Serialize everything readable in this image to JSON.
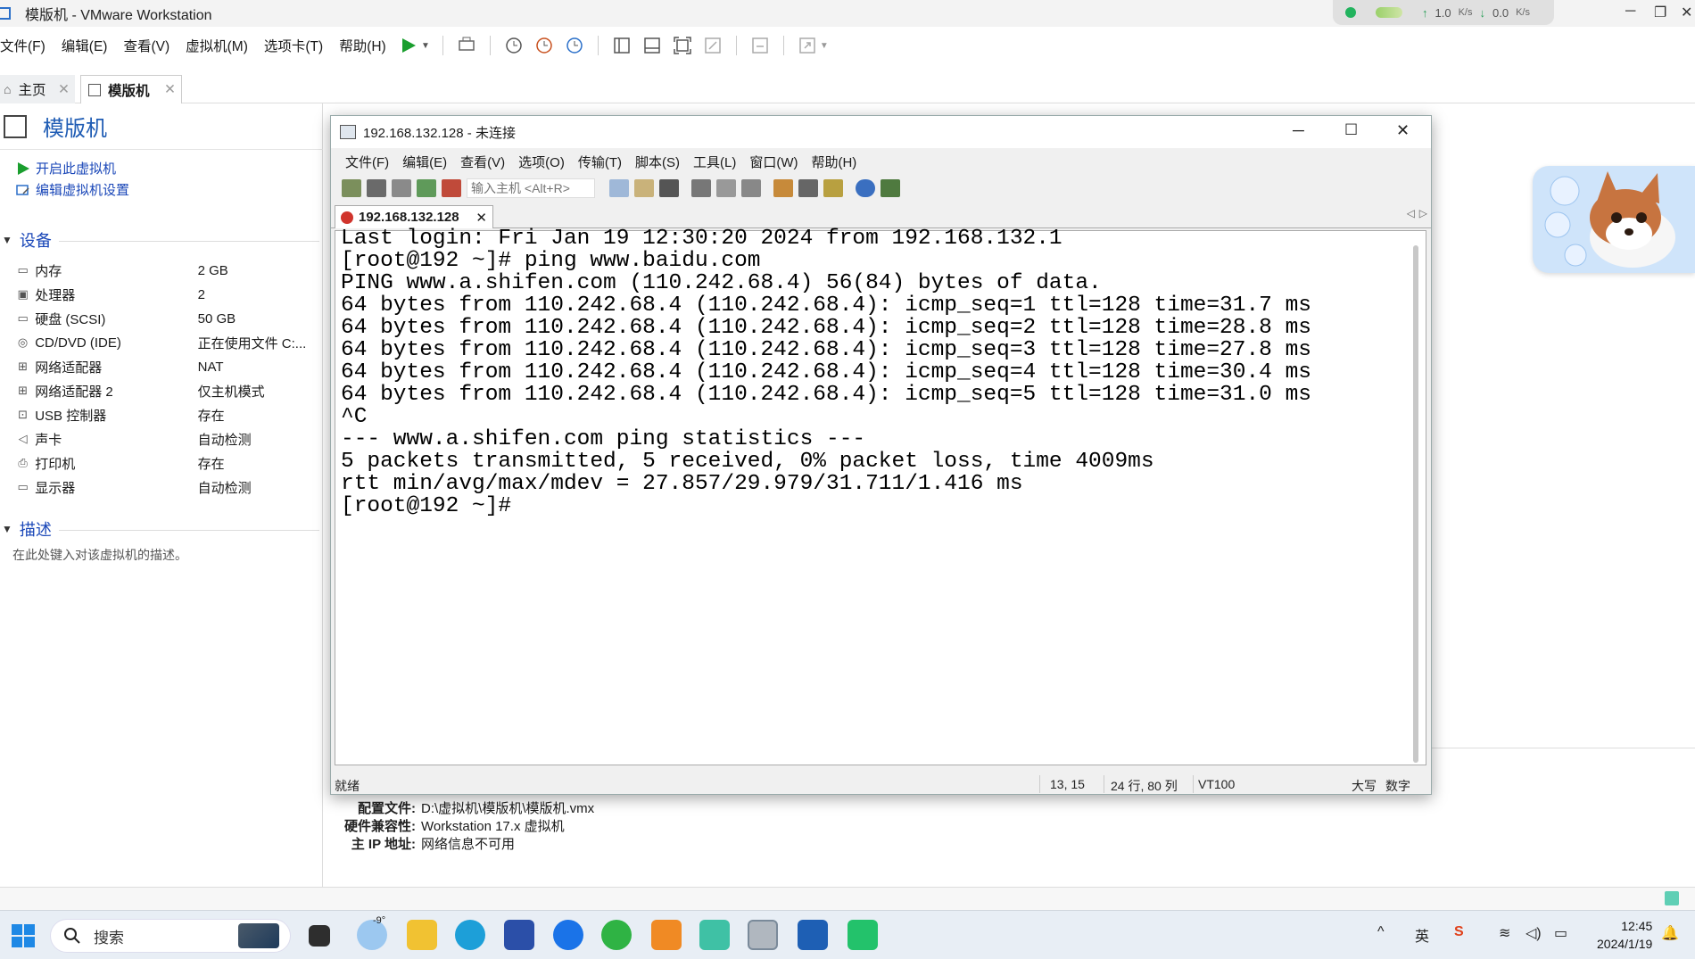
{
  "window": {
    "title": "模版机 - VMware Workstation"
  },
  "net": {
    "up": "1.0",
    "up_unit": "K/s",
    "down": "0.0",
    "down_unit": "K/s"
  },
  "menu": [
    "文件(F)",
    "编辑(E)",
    "查看(V)",
    "虚拟机(M)",
    "选项卡(T)",
    "帮助(H)"
  ],
  "tabs": {
    "home": "主页",
    "vm": "模版机"
  },
  "vm": {
    "name": "模版机",
    "actions": {
      "power_on": "开启此虚拟机",
      "edit_settings": "编辑虚拟机设置"
    },
    "devices_title": "设备",
    "devices": [
      {
        "name": "内存",
        "value": "2 GB"
      },
      {
        "name": "处理器",
        "value": "2"
      },
      {
        "name": "硬盘 (SCSI)",
        "value": "50 GB"
      },
      {
        "name": "CD/DVD (IDE)",
        "value": "正在使用文件 C:..."
      },
      {
        "name": "网络适配器",
        "value": "NAT"
      },
      {
        "name": "网络适配器 2",
        "value": "仅主机模式"
      },
      {
        "name": "USB 控制器",
        "value": "存在"
      },
      {
        "name": "声卡",
        "value": "自动检测"
      },
      {
        "name": "打印机",
        "value": "存在"
      },
      {
        "name": "显示器",
        "value": "自动检测"
      }
    ],
    "desc_title": "描述",
    "desc_placeholder": "在此处键入对该虚拟机的描述。",
    "details": [
      {
        "k": "配置文件:",
        "v": "D:\\虚拟机\\模版机\\模版机.vmx"
      },
      {
        "k": "硬件兼容性:",
        "v": "Workstation 17.x 虚拟机"
      },
      {
        "k": "主 IP 地址:",
        "v": "网络信息不可用"
      }
    ]
  },
  "xshell": {
    "title": "192.168.132.128 - 未连接",
    "menu": [
      "文件(F)",
      "编辑(E)",
      "查看(V)",
      "选项(O)",
      "传输(T)",
      "脚本(S)",
      "工具(L)",
      "窗口(W)",
      "帮助(H)"
    ],
    "host_placeholder": "输入主机 <Alt+R>",
    "tab": "192.168.132.128",
    "terminal_lines": [
      "Last login: Fri Jan 19 12:30:20 2024 from 192.168.132.1",
      "[root@192 ~]# ping www.baidu.com",
      "PING www.a.shifen.com (110.242.68.4) 56(84) bytes of data.",
      "64 bytes from 110.242.68.4 (110.242.68.4): icmp_seq=1 ttl=128 time=31.7 ms",
      "64 bytes from 110.242.68.4 (110.242.68.4): icmp_seq=2 ttl=128 time=28.8 ms",
      "64 bytes from 110.242.68.4 (110.242.68.4): icmp_seq=3 ttl=128 time=27.8 ms",
      "64 bytes from 110.242.68.4 (110.242.68.4): icmp_seq=4 ttl=128 time=30.4 ms",
      "64 bytes from 110.242.68.4 (110.242.68.4): icmp_seq=5 ttl=128 time=31.0 ms",
      "^C",
      "--- www.a.shifen.com ping statistics ---",
      "5 packets transmitted, 5 received, 0% packet loss, time 4009ms",
      "rtt min/avg/max/mdev = 27.857/29.979/31.711/1.416 ms",
      "[root@192 ~]#"
    ],
    "status": {
      "ready": "就绪",
      "cursor": "13,  15",
      "size": "24 行, 80 列",
      "term": "VT100",
      "caps": "大写",
      "num": "数字"
    }
  },
  "taskbar": {
    "search": "搜索",
    "weather": "-9°",
    "tray_lang": "英",
    "time": "12:45",
    "date": "2024/1/19"
  },
  "colors": {
    "accent": "#1a47b8",
    "play": "#1a9e2e",
    "taskbar": "#e8eef5"
  }
}
